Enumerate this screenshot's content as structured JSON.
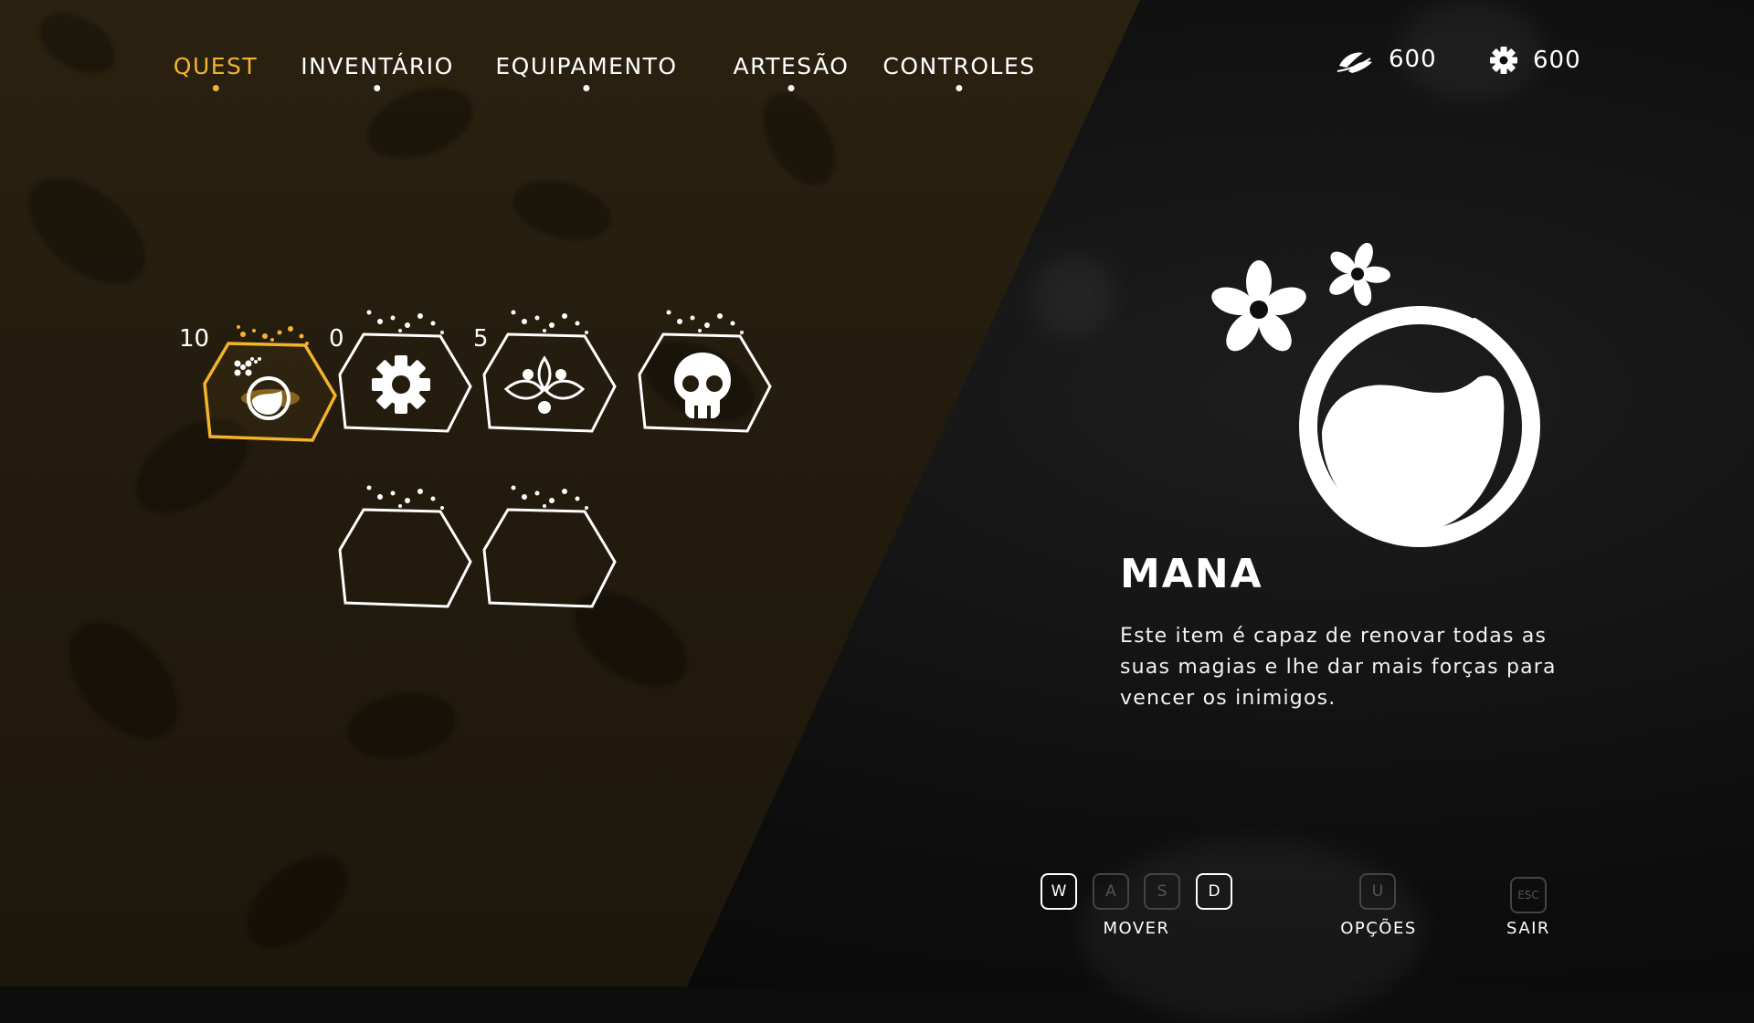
{
  "nav": {
    "items": [
      {
        "label": "QUEST",
        "active": true
      },
      {
        "label": "INVENTÁRIO",
        "active": false
      },
      {
        "label": "EQUIPAMENTO",
        "active": false
      },
      {
        "label": "ARTESÃO",
        "active": false
      },
      {
        "label": "CONTROLES",
        "active": false
      }
    ]
  },
  "currency": [
    {
      "icon": "leaves-icon",
      "value": "600"
    },
    {
      "icon": "gear-icon",
      "value": "600"
    }
  ],
  "inventory": {
    "slots": [
      {
        "icon": "mana-potion-icon",
        "count": "10",
        "selected": true
      },
      {
        "icon": "gear-icon",
        "count": "0",
        "selected": false
      },
      {
        "icon": "flower-emblem-icon",
        "count": "5",
        "selected": false
      },
      {
        "icon": "skull-icon",
        "count": "",
        "selected": false
      },
      {
        "icon": "",
        "count": "",
        "selected": false
      },
      {
        "icon": "",
        "count": "",
        "selected": false
      }
    ]
  },
  "detail": {
    "icon": "mana-potion-icon",
    "title": "MANA",
    "description": "Este item é capaz de renovar todas as suas magias e lhe dar mais forças para vencer os inimigos."
  },
  "controls": {
    "keys": [
      {
        "key": "W",
        "active": true
      },
      {
        "key": "A",
        "active": false
      },
      {
        "key": "S",
        "active": false
      },
      {
        "key": "D",
        "active": true
      },
      {
        "key": "U",
        "active": false
      },
      {
        "key": "ESC",
        "active": false
      }
    ],
    "labels": {
      "move": "MOVER",
      "options": "OPÇÕES",
      "exit": "SAIR"
    }
  },
  "colors": {
    "accent": "#f3b32d",
    "panel": "#241c0e",
    "dark": "#0d0d0d"
  }
}
